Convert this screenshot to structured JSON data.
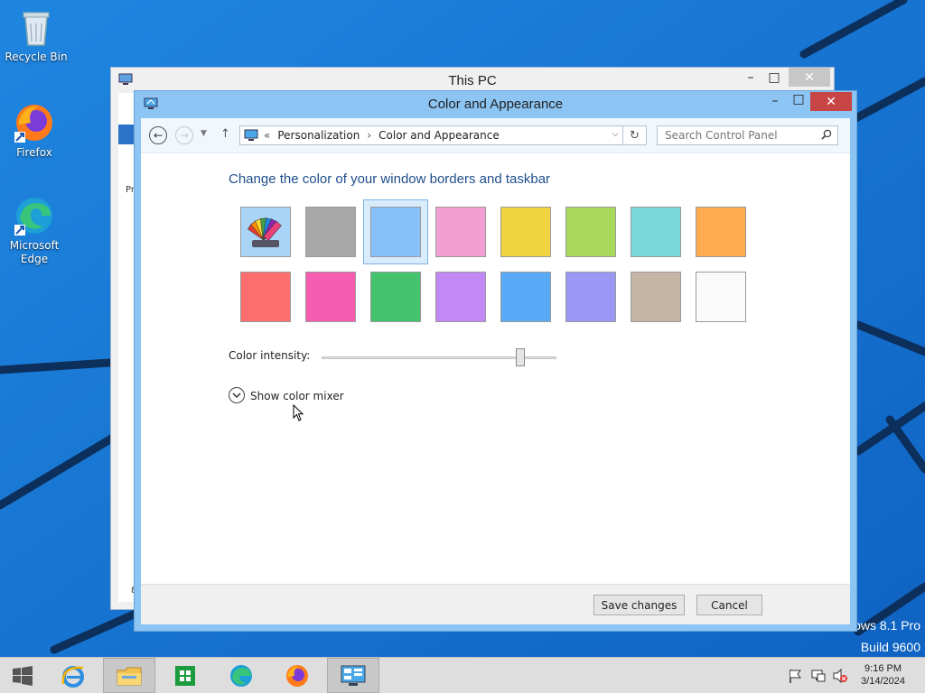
{
  "desktop": {
    "icons": [
      {
        "label": "Recycle Bin",
        "icon": "recycle-bin-icon"
      },
      {
        "label": "Firefox",
        "icon": "firefox-icon"
      },
      {
        "label": "Microsoft Edge",
        "icon": "edge-icon"
      }
    ],
    "watermark": {
      "line1": "ows 8.1 Pro",
      "line2": "Build 9600"
    }
  },
  "background_window": {
    "title": "This PC",
    "buttons": {
      "minimize": "–",
      "maximize": "□",
      "close": "✕"
    },
    "partial_text": {
      "pr": "Pr",
      "eight": "8"
    }
  },
  "window": {
    "title": "Color and Appearance",
    "buttons": {
      "minimize": "–",
      "maximize": "□",
      "close": "✕"
    },
    "address": {
      "chevron": "«",
      "breadcrumb": [
        "Personalization",
        "Color and Appearance"
      ],
      "separator": "›"
    },
    "search": {
      "placeholder": "Search Control Panel"
    },
    "heading": "Change the color of your window borders and taskbar",
    "swatches_row1": [
      "automatic",
      "#a8a8a8",
      "#86c2f9",
      "#f39ed3",
      "#f2d340",
      "#a8d85c",
      "#7bd8d8",
      "#ffab4f"
    ],
    "swatches_row2": [
      "#ff6e6e",
      "#f65cb0",
      "#45c26e",
      "#c288f5",
      "#58aaf7",
      "#9a97f5",
      "#c4b5a5",
      "#fafafa"
    ],
    "selected_swatch": 2,
    "intensity": {
      "label": "Color intensity:",
      "value": 0.86
    },
    "mixer": {
      "label": "Show color mixer"
    },
    "footer": {
      "save": "Save changes",
      "cancel": "Cancel"
    }
  },
  "taskbar": {
    "items": [
      "internet-explorer-icon",
      "file-explorer-icon",
      "store-icon",
      "edge-icon",
      "firefox-icon",
      "control-panel-icon"
    ],
    "active": 5,
    "clock": {
      "time": "9:16 PM",
      "date": "3/14/2024"
    }
  },
  "colors": {
    "accent": "#8cc4f3",
    "desktop": "#1677d6",
    "heading": "#1e4e8c"
  }
}
